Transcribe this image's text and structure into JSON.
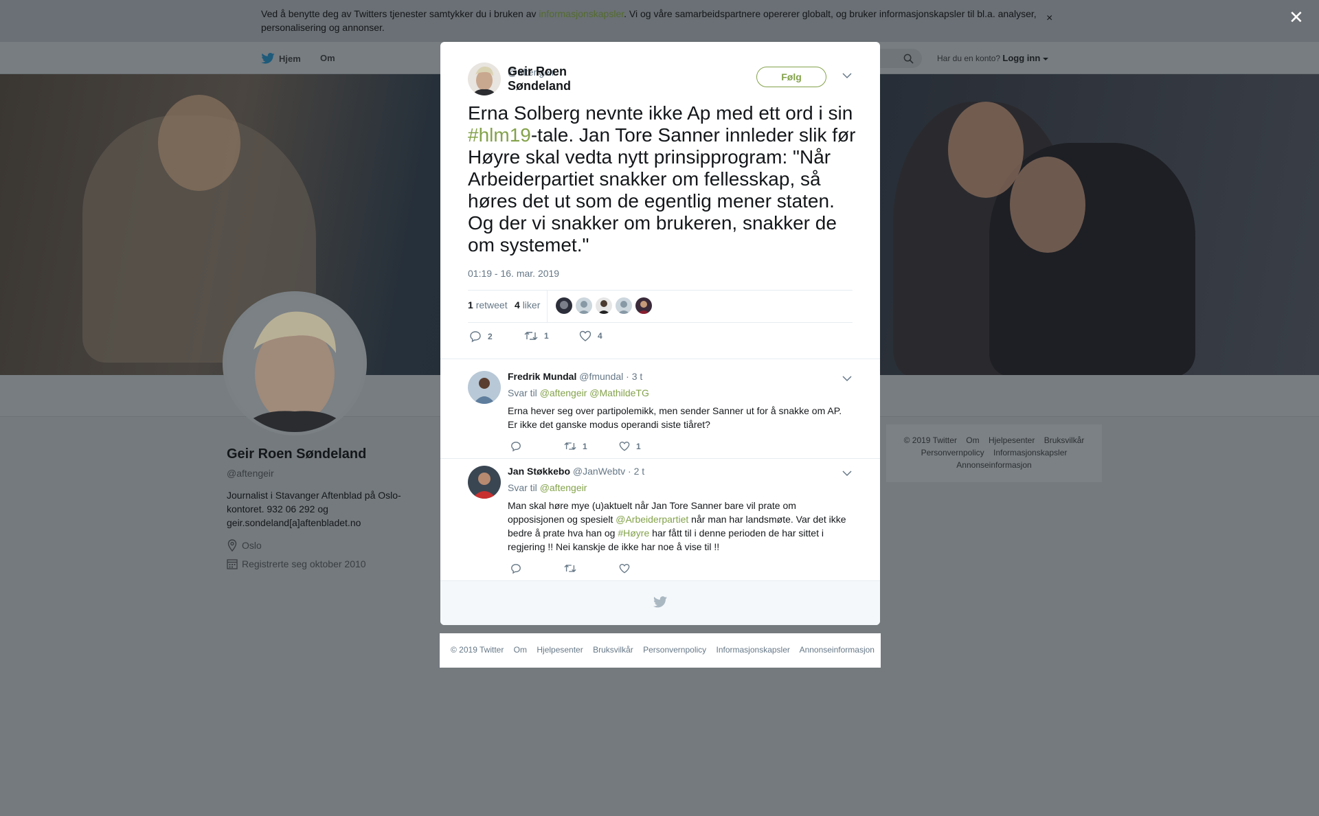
{
  "cookie_banner": {
    "text_before": "Ved å benytte deg av Twitters tjenester samtykker du i bruken av ",
    "link": "informasjonskapsler",
    "text_after": ". Vi og våre samarbeidspartnere opererer globalt, og bruker informasjonskapsler til bl.a. analyser, personalisering og annonser.",
    "close": "×"
  },
  "nav": {
    "home": "Hjem",
    "about": "Om",
    "login_prompt": "Har du en konto?",
    "login": "Logg inn"
  },
  "profile": {
    "name": "Geir Roen Søndeland",
    "handle": "@aftengeir",
    "bio": "Journalist i Stavanger Aftenblad på Oslo-kontoret. 932 06 292 og geir.sondeland[a]aftenbladet.no",
    "location": "Oslo",
    "joined": "Registrerte seg oktober 2010"
  },
  "side_footer": {
    "row1": [
      "© 2019 Twitter",
      "Om",
      "Hjelpesenter",
      "Bruksvilkår"
    ],
    "row2": [
      "Personvernpolicy",
      "Informasjonskapsler"
    ],
    "row3": [
      "Annonseinformasjon"
    ]
  },
  "overlay_close": "✕",
  "tweet": {
    "author_name": "Geir Roen Søndeland",
    "author_handle": "@aftengeir",
    "follow_label": "Følg",
    "text_before": "Erna Solberg nevnte ikke Ap med ett ord i sin ",
    "hashtag": "#hlm19",
    "text_after": "-tale.  Jan Tore Sanner innleder slik før Høyre skal vedta nytt prinsipprogram: \"Når Arbeiderpartiet snakker om fellesskap, så høres det ut som de egentlig mener staten. Og der vi snakker om brukeren, snakker de om systemet.\"",
    "timestamp": "01:19 - 16. mar. 2019",
    "retweet_count": "1",
    "retweet_label": "retweet",
    "like_count": "4",
    "like_label": "liker",
    "actions": {
      "replies": "2",
      "retweets": "1",
      "likes": "4"
    }
  },
  "replies": [
    {
      "name": "Fredrik Mundal",
      "handle": "@fmundal",
      "time": "· 3 t",
      "reply_to_label": "Svar til",
      "reply_to_1": "@aftengeir",
      "reply_to_2": "@MathildeTG",
      "text": "Erna hever seg over partipolemikk, men sender Sanner ut for å snakke om AP. Er ikke det ganske modus operandi siste tiåret?",
      "retweets": "1",
      "likes": "1"
    },
    {
      "name": "Jan Støkkebo",
      "handle": "@JanWebtv",
      "time": "· 2 t",
      "reply_to_label": "Svar til",
      "reply_to_1": "@aftengeir",
      "text_1": "Man skal høre mye (u)aktuelt når Jan Tore Sanner bare vil prate om opposisjonen og spesielt ",
      "mention": "@Arbeiderpartiet",
      "text_2": " når man har landsmøte. Var det ikke bedre å prate hva han og ",
      "hashtag": "#Høyre",
      "text_3": " har fått til i denne perioden de har sittet i regjering !! Nei kanskje de ikke har noe å vise til !!"
    }
  ],
  "footer": [
    "© 2019 Twitter",
    "Om",
    "Hjelpesenter",
    "Bruksvilkår",
    "Personvernpolicy",
    "Informasjonskapsler",
    "Annonseinformasjon"
  ]
}
